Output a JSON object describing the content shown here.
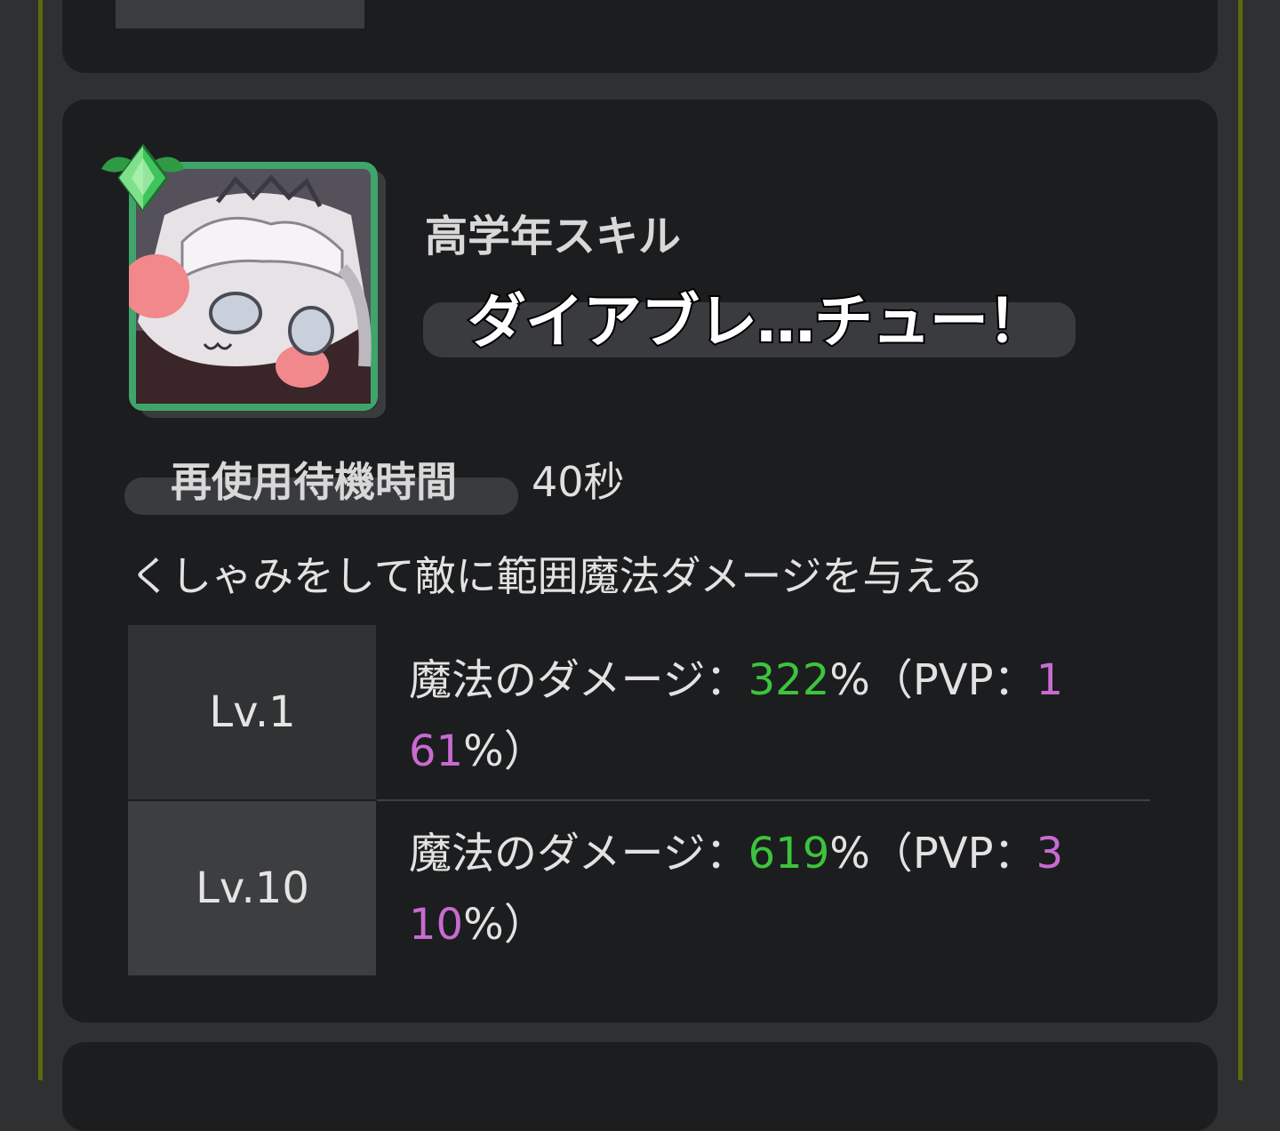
{
  "skill": {
    "type_label": "高学年スキル",
    "name": "ダイアブレ…チュー！",
    "cooldown_label": "再使用待機時間",
    "cooldown_value": "40秒",
    "description": "くしゃみをして敵に範囲魔法ダメージを与える"
  },
  "levels": [
    {
      "label": "Lv.1",
      "effect_prefix": "魔法のダメージ：",
      "damage": "322",
      "pvp_open": "%（PVP：",
      "pvp_line1": "1",
      "pvp_line2": "61",
      "close": "%）"
    },
    {
      "label": "Lv.10",
      "effect_prefix": "魔法のダメージ：",
      "damage": "619",
      "pvp_open": "%（PVP：",
      "pvp_line1": "3",
      "pvp_line2": "10",
      "close": "%）"
    }
  ],
  "colors": {
    "damage": "#3cc43c",
    "pvp": "#c86bd0",
    "avatar_border": "#3fa56b",
    "rail": "#5c6a10"
  },
  "icons": {
    "gem": "green-gem-icon",
    "portrait": "character-portrait"
  }
}
